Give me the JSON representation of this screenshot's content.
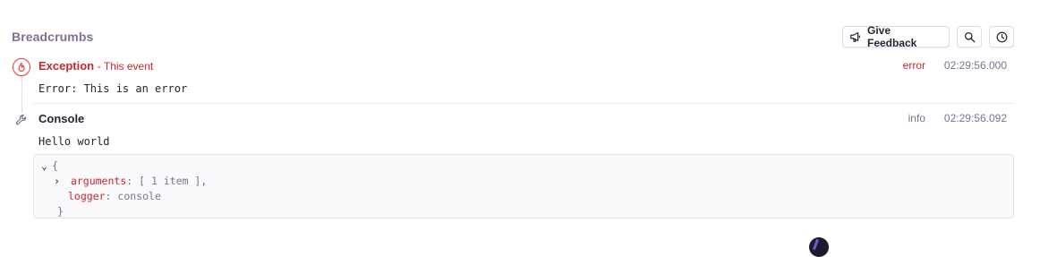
{
  "section": {
    "title": "Breadcrumbs"
  },
  "toolbar": {
    "feedback_label": "Give Feedback",
    "search_icon": "search-icon",
    "time_icon": "clock-icon"
  },
  "crumbs": [
    {
      "title": "Exception",
      "subtitle": "- This event",
      "level": "error",
      "time": "02:29:56.000",
      "message": "Error: This is an error",
      "icon": "fire-icon",
      "color": "#c7282f"
    },
    {
      "title": "Console",
      "level": "info",
      "time": "02:29:56.092",
      "message": "Hello world",
      "icon": "wrench-icon",
      "data": {
        "open_brace": "{",
        "arguments_key": "arguments",
        "arguments_value": "[ 1 item ],",
        "logger_key": "logger",
        "logger_value": "console",
        "close_brace": "}"
      }
    }
  ]
}
